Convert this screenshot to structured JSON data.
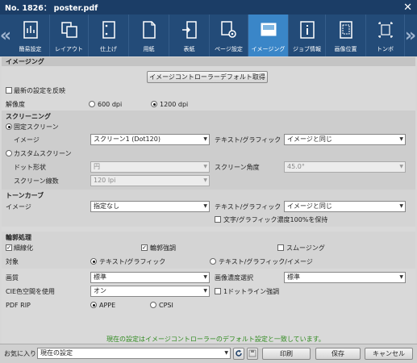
{
  "window": {
    "title": "No. 1826： poster.pdf",
    "close_icon": "close-icon"
  },
  "toolbar": {
    "tabs": [
      {
        "label": "簡易設定",
        "icon": "easy-settings-icon"
      },
      {
        "label": "レイアウト",
        "icon": "layout-icon"
      },
      {
        "label": "仕上げ",
        "icon": "finishing-icon"
      },
      {
        "label": "用紙",
        "icon": "paper-icon"
      },
      {
        "label": "表紙",
        "icon": "cover-icon"
      },
      {
        "label": "ページ設定",
        "icon": "page-settings-icon"
      },
      {
        "label": "イメージング",
        "icon": "imaging-icon",
        "active": true
      },
      {
        "label": "ジョブ情報",
        "icon": "job-info-icon"
      },
      {
        "label": "画像位置",
        "icon": "image-position-icon"
      },
      {
        "label": "トンボ",
        "icon": "crop-marks-icon"
      }
    ],
    "prev_arrow": "«",
    "next_arrow": "»"
  },
  "imaging": {
    "section_title": "イメージング",
    "default_button": "イメージコントローラーデフォルト取得",
    "reflect_latest": "最新の設定を反映",
    "resolution_label": "解像度",
    "res_600": "600 dpi",
    "res_1200": "1200 dpi",
    "resolution_selected": "1200 dpi"
  },
  "screening": {
    "title": "スクリーニング",
    "fixed_screen": "固定スクリーン",
    "image_label": "イメージ",
    "image_value": "スクリーン1 (Dot120)",
    "text_graphic_label": "テキスト/グラフィック",
    "text_graphic_value": "イメージと同じ",
    "custom_screen": "カスタムスクリーン",
    "dot_shape_label": "ドット形状",
    "dot_shape_value": "円",
    "screen_angle_label": "スクリーン角度",
    "screen_angle_value": "45.0°",
    "screen_lines_label": "スクリーン線数",
    "screen_lines_value": "120 lpi"
  },
  "tone_curve": {
    "title": "トーンカーブ",
    "image_label": "イメージ",
    "image_value": "指定なし",
    "text_graphic_label": "テキスト/グラフィック",
    "text_graphic_value": "イメージと同じ",
    "keep_100": "文字/グラフィック濃度100%を保持"
  },
  "edge": {
    "title": "輪郭処理",
    "thinning": "細線化",
    "emphasis": "輪郭強調",
    "smoothing": "スムージング",
    "target_label": "対象",
    "target_text": "テキスト/グラフィック",
    "target_text_image": "テキスト/グラフィック/イメージ"
  },
  "quality": {
    "label": "画質",
    "value": "標準",
    "density_label": "画像濃度選択",
    "density_value": "標準",
    "cie_label": "CIE色空間を使用",
    "cie_value": "オン",
    "dotline_label": "1ドットライン強調",
    "pdf_rip_label": "PDF RIP",
    "appe": "APPE",
    "cpsi": "CPSI"
  },
  "status": {
    "message": "現在の設定はイメージコントローラーのデフォルト設定と一致しています。"
  },
  "footer": {
    "favorites_label": "お気に入り",
    "favorites_value": "現在の設定",
    "refresh_icon": "refresh-icon",
    "save_icon": "save-icon",
    "print": "印刷",
    "save": "保存",
    "cancel": "キャンセル"
  },
  "colors": {
    "title_bar": "#1b3d66",
    "toolbar": "#234b78",
    "active_tab": "#3a86c8",
    "status_text": "#2f8a1e"
  }
}
